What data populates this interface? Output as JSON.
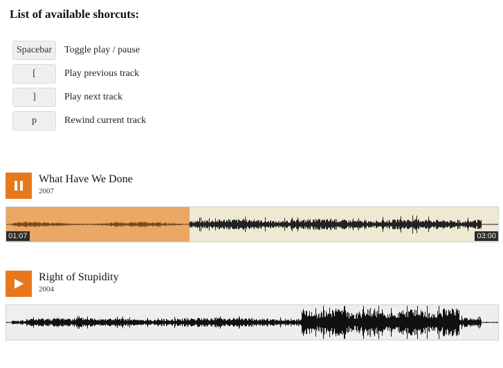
{
  "heading": "List of available shorcuts:",
  "shortcuts": [
    {
      "key": "Spacebar",
      "description": "Toggle play / pause"
    },
    {
      "key": "[",
      "description": "Play previous track"
    },
    {
      "key": "]",
      "description": "Play next track"
    },
    {
      "key": "p",
      "description": "Rewind current track"
    }
  ],
  "tracks": [
    {
      "title": "What Have We Done",
      "year": "2007",
      "state": "playing",
      "button_icon": "pause-icon",
      "current_time": "01:07",
      "duration": "03:00",
      "progress": 0.3722,
      "colors": {
        "button": "#e8781d",
        "played": "#eaa765",
        "unplayed": "#efe8d3",
        "wave_played": "#7a4a1c",
        "wave": "#222222"
      }
    },
    {
      "title": "Right of Stupidity",
      "year": "2004",
      "state": "stopped",
      "button_icon": "play-icon",
      "colors": {
        "button": "#e8781d",
        "unplayed": "#eeeeee",
        "wave": "#111111"
      }
    }
  ]
}
